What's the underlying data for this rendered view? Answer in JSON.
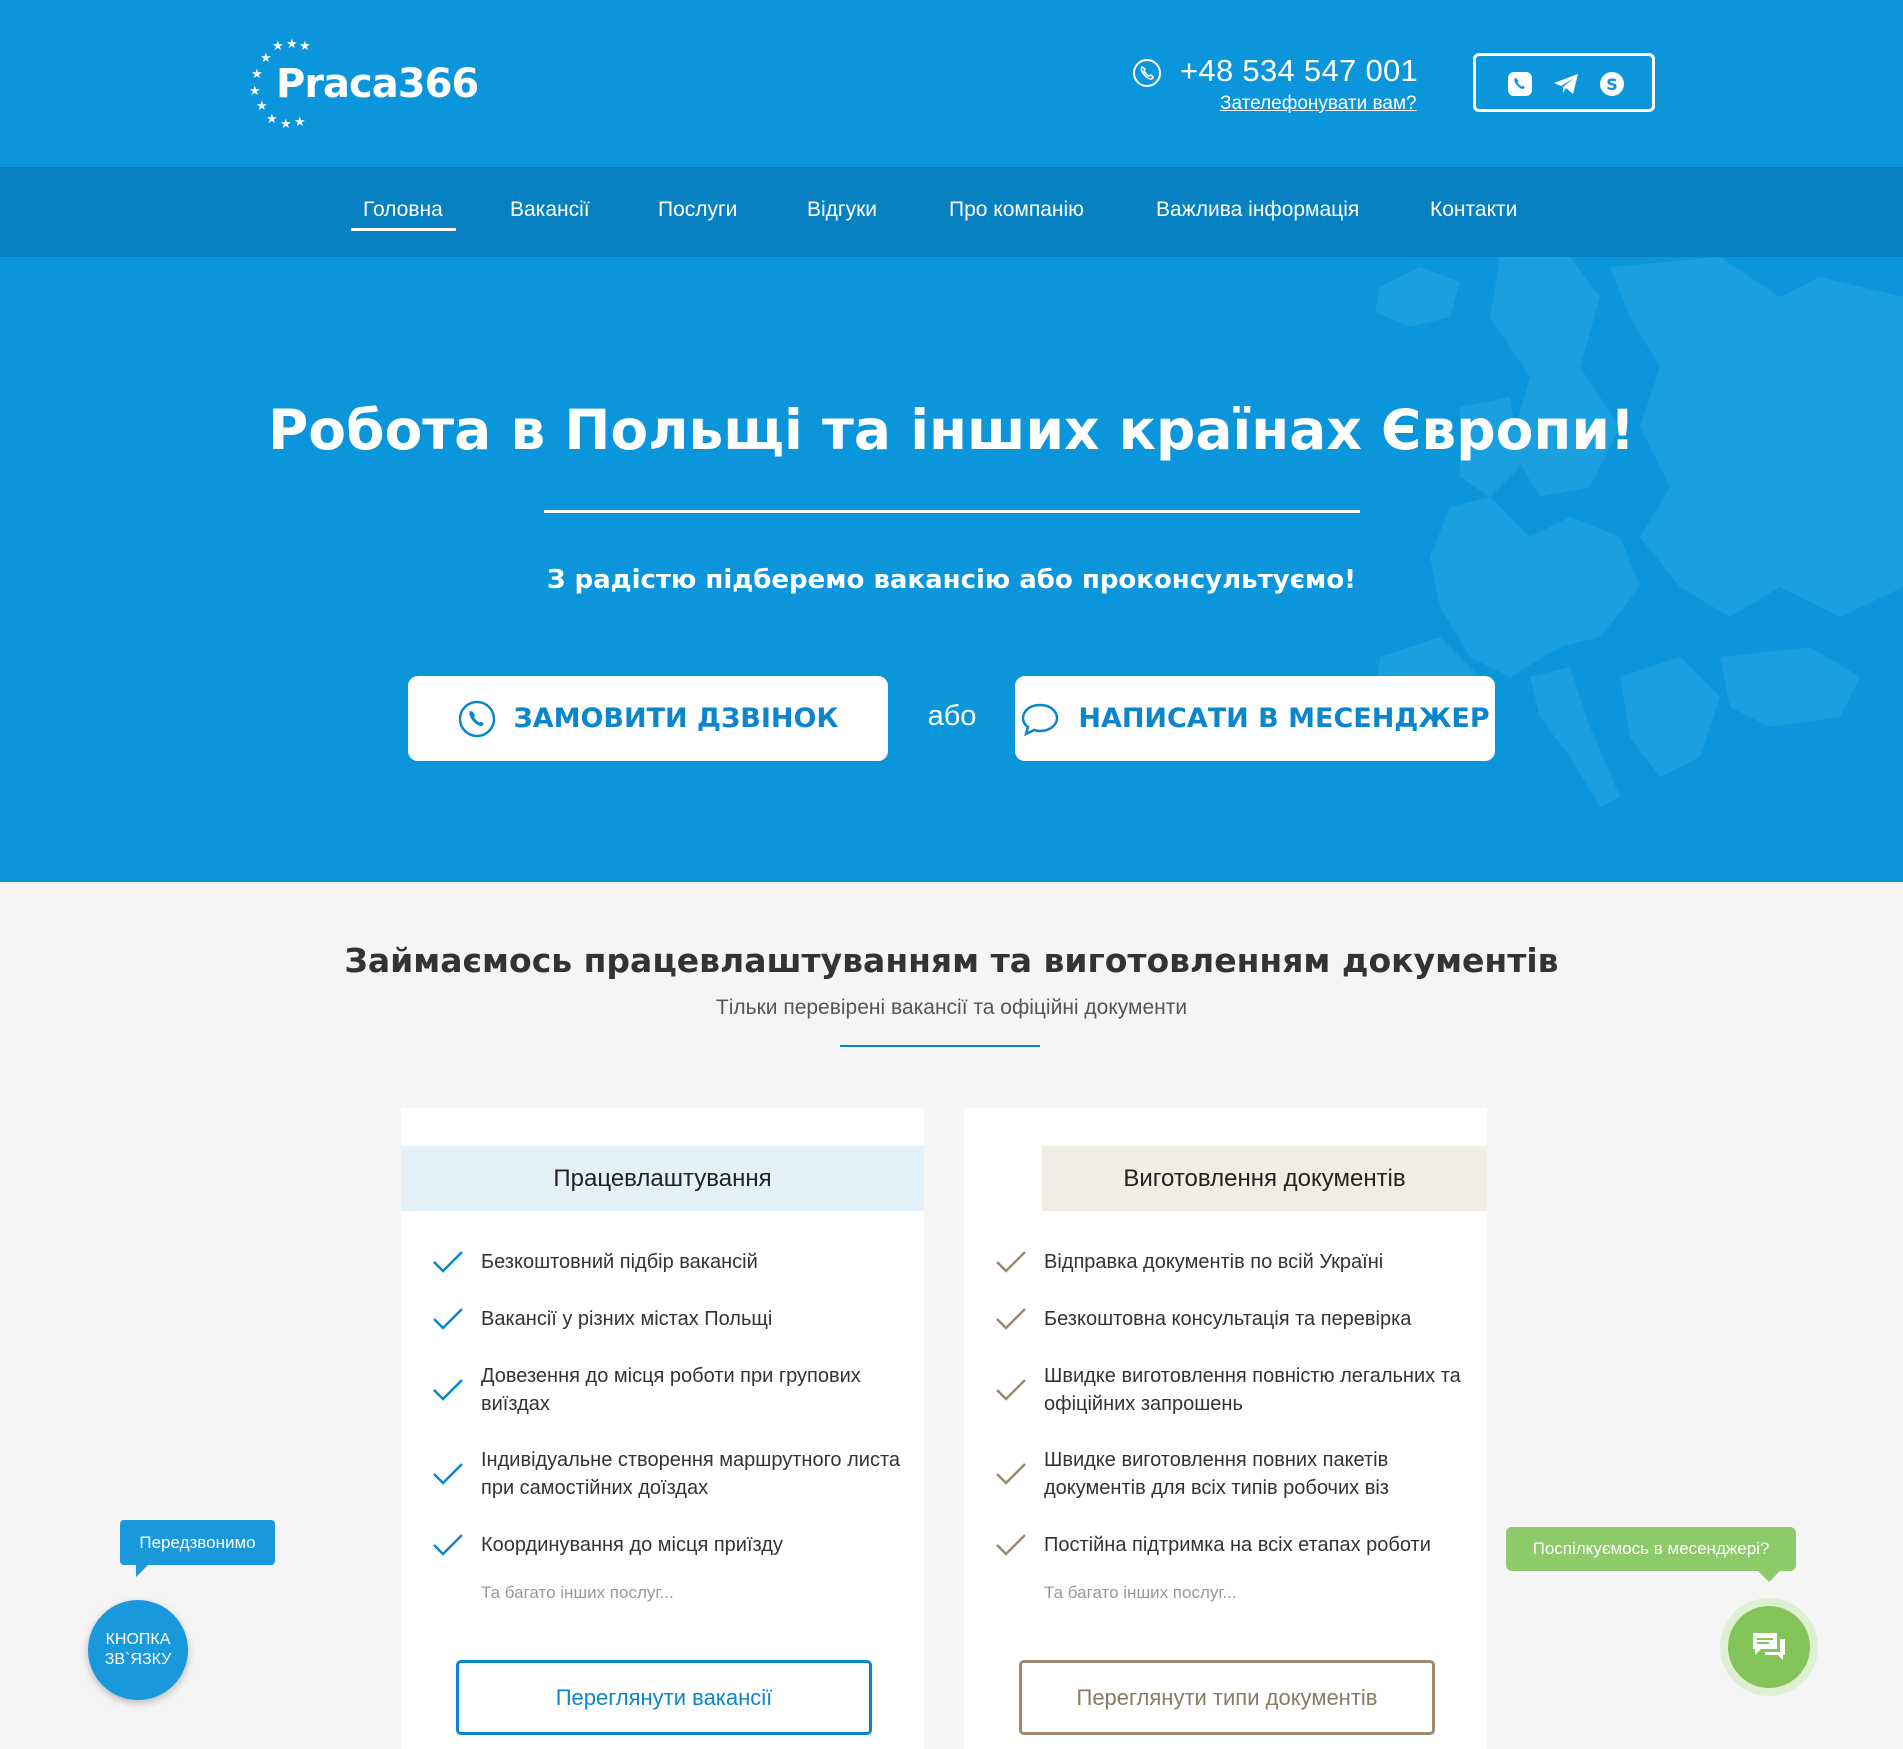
{
  "header": {
    "logo_text": "Praca366",
    "phone": "+48 534 547 001",
    "callback_link": "Зателефонувати вам?",
    "messengers": [
      "viber-icon",
      "telegram-icon",
      "skype-icon"
    ]
  },
  "nav": {
    "items": [
      {
        "label": "Головна",
        "active": true
      },
      {
        "label": "Вакансії"
      },
      {
        "label": "Послуги"
      },
      {
        "label": "Відгуки"
      },
      {
        "label": "Про компанію"
      },
      {
        "label": "Важлива інформація"
      },
      {
        "label": "Контакти"
      }
    ]
  },
  "hero": {
    "title": "Робота в Польщі та інших країнах Європи!",
    "subtitle": "З радістю підберемо вакансію або проконсультуємо!",
    "call_button": "ЗАМОВИТИ ДЗВІНОК",
    "or_text": "або",
    "messenger_button": "НАПИСАТИ В МЕСЕНДЖЕР"
  },
  "services": {
    "title": "Займаємось працевлаштуванням та виготовленням документів",
    "subtitle": "Тільки перевірені вакансії та офіційні документи",
    "cards": [
      {
        "heading": "Працевлаштування",
        "items": [
          "Безкоштовний підбір вакансій",
          "Вакансії у різних містах Польщі",
          "Довезення до місця роботи при групових виїздах",
          "Індивідуальне створення маршрутного листа при самостійних доїздах",
          "Координування до місця приїзду"
        ],
        "more": "Та багато інших послуг...",
        "button": "Переглянути вакансії"
      },
      {
        "heading": "Виготовлення документів",
        "items": [
          "Відправка документів по всій Україні",
          "Безкоштовна консультація та перевірка",
          "Швидке виготовлення повністю легальних та офіційних запрошень",
          "Швидке виготовлення повних пакетів документів для всіх типів робочих віз",
          "Постійна підтримка на всіх етапах роботи"
        ],
        "more": "Та багато інших послуг...",
        "button": "Переглянути типи документів"
      }
    ]
  },
  "floating": {
    "callback_tip": "Передзвонимо",
    "contact_button": "КНОПКА ЗВ`ЯЗКУ",
    "messenger_tip": "Поспілкуємось в месенджері?"
  },
  "colors": {
    "primary": "#0b96dc",
    "nav": "#0781c2",
    "accent_blue": "#0b86cc",
    "accent_tan": "#9b8a70",
    "card_head_blue": "#e3f2fa",
    "card_head_tan": "#f0ede3",
    "green": "#84c45b"
  }
}
